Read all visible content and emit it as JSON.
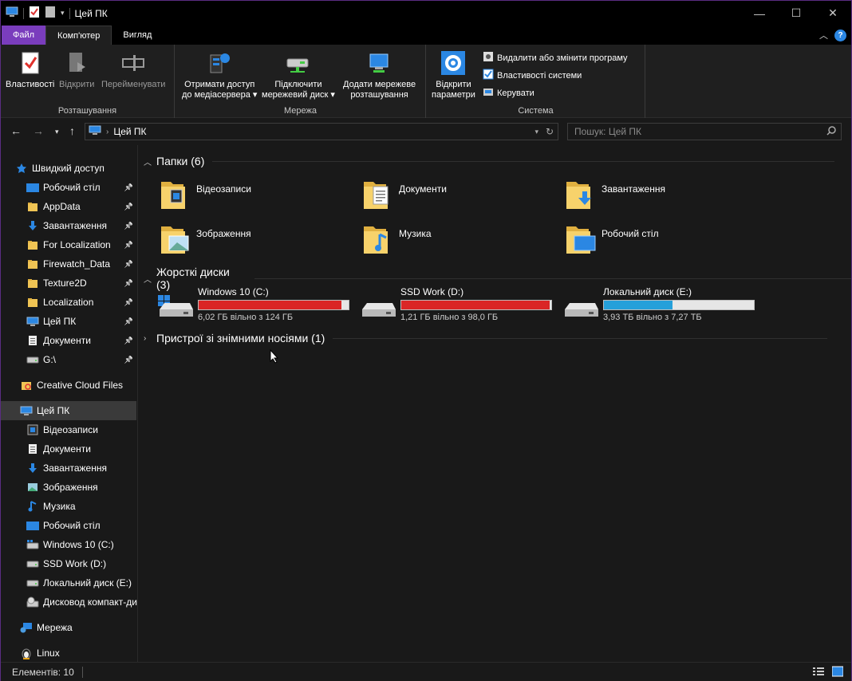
{
  "window": {
    "title": "Цей ПК",
    "minimize": "—",
    "maximize": "☐",
    "close": "✕"
  },
  "ribbon_tabs": [
    {
      "label": "Файл"
    },
    {
      "label": "Комп'ютер"
    },
    {
      "label": "Вигляд"
    }
  ],
  "ribbon": {
    "groups": [
      {
        "label": "Розташування",
        "buttons": [
          {
            "label": "Властивості"
          },
          {
            "label": "Відкрити"
          },
          {
            "label": "Перейменувати"
          }
        ]
      },
      {
        "label": "Мережа",
        "buttons": [
          {
            "line1": "Отримати доступ",
            "line2": "до медіасервера"
          },
          {
            "line1": "Підключити",
            "line2": "мережевий диск"
          },
          {
            "line1": "Додати мережеве",
            "line2": "розташування"
          }
        ]
      },
      {
        "label": "Система",
        "buttons": [
          {
            "line1": "Відкрити",
            "line2": "параметри"
          }
        ],
        "small_buttons": [
          {
            "label": "Видалити або змінити програму"
          },
          {
            "label": "Властивості системи"
          },
          {
            "label": "Керувати"
          }
        ]
      }
    ]
  },
  "address": {
    "path": "Цей ПК",
    "search_placeholder": "Пошук: Цей ПК"
  },
  "sidebar": {
    "quick_access": {
      "label": "Швидкий доступ"
    },
    "quick_items": [
      {
        "label": "Робочий стіл",
        "icon": "desktop-icon"
      },
      {
        "label": "AppData",
        "icon": "folder-icon"
      },
      {
        "label": "Завантаження",
        "icon": "download-icon"
      },
      {
        "label": "For Localization",
        "icon": "folder-icon"
      },
      {
        "label": "Firewatch_Data",
        "icon": "folder-icon"
      },
      {
        "label": "Texture2D",
        "icon": "folder-icon"
      },
      {
        "label": "Localization",
        "icon": "folder-icon"
      },
      {
        "label": "Цей ПК",
        "icon": "computer-icon"
      },
      {
        "label": "Документи",
        "icon": "documents-icon"
      },
      {
        "label": "G:\\",
        "icon": "drive-icon"
      }
    ],
    "creative_cloud": {
      "label": "Creative Cloud Files"
    },
    "this_pc": {
      "label": "Цей ПК"
    },
    "pc_items": [
      {
        "label": "Відеозаписи",
        "icon": "videos-icon"
      },
      {
        "label": "Документи",
        "icon": "documents-icon"
      },
      {
        "label": "Завантаження",
        "icon": "download-icon"
      },
      {
        "label": "Зображення",
        "icon": "pictures-icon"
      },
      {
        "label": "Музика",
        "icon": "music-icon"
      },
      {
        "label": "Робочий стіл",
        "icon": "desktop-icon"
      },
      {
        "label": "Windows 10 (C:)",
        "icon": "windows-drive-icon"
      },
      {
        "label": "SSD Work (D:)",
        "icon": "drive-icon"
      },
      {
        "label": "Локальний диск (E:)",
        "icon": "drive-icon"
      },
      {
        "label": "Дисковод компакт-диск",
        "icon": "cd-drive-icon"
      }
    ],
    "network": {
      "label": "Мережа"
    },
    "linux": {
      "label": "Linux"
    }
  },
  "content": {
    "folders_header": "Папки (6)",
    "folders": [
      {
        "label": "Відеозаписи",
        "icon": "videos-folder-icon"
      },
      {
        "label": "Документи",
        "icon": "documents-folder-icon"
      },
      {
        "label": "Завантаження",
        "icon": "downloads-folder-icon"
      },
      {
        "label": "Зображення",
        "icon": "pictures-folder-icon"
      },
      {
        "label": "Музика",
        "icon": "music-folder-icon"
      },
      {
        "label": "Робочий стіл",
        "icon": "desktop-folder-icon"
      }
    ],
    "drives_header": "Жорсткі диски (3)",
    "drives": [
      {
        "name": "Windows 10 (C:)",
        "free": "6,02 ГБ вільно з 124 ГБ",
        "used_fraction": 0.95,
        "color": "#da2626"
      },
      {
        "name": "SSD Work (D:)",
        "free": "1,21 ГБ вільно з 98,0 ГБ",
        "used_fraction": 0.99,
        "color": "#da2626"
      },
      {
        "name": "Локальний диск (E:)",
        "free": "3,93 ТБ вільно з 7,27 ТБ",
        "used_fraction": 0.46,
        "color": "#26a0da"
      }
    ],
    "removable_header": "Пристрої зі знімними носіями (1)"
  },
  "status": {
    "items": "Елементів: 10"
  },
  "colors": {
    "accent": "#7a3dbd",
    "bar_red": "#da2626",
    "bar_blue": "#26a0da"
  }
}
